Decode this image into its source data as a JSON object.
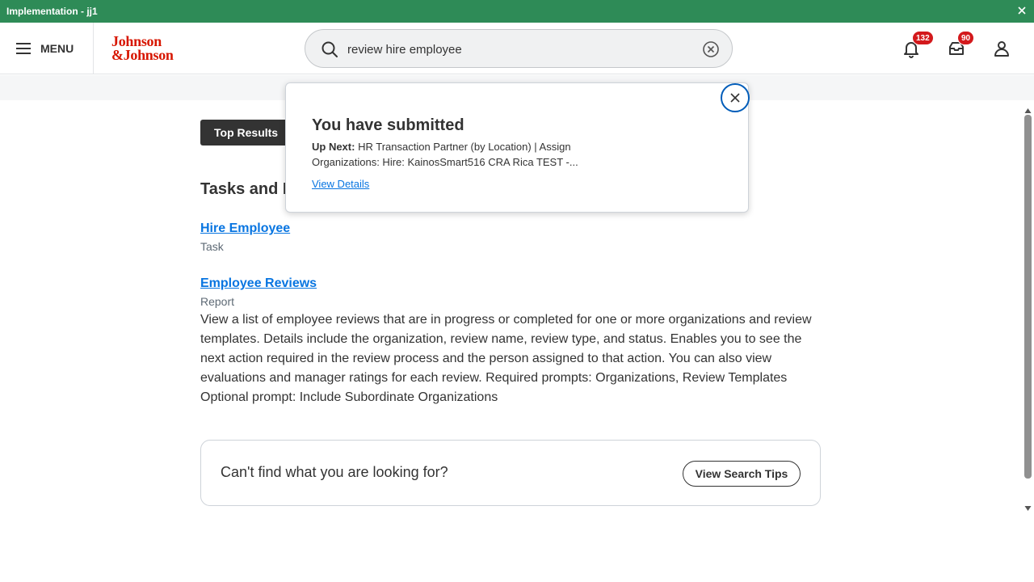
{
  "window": {
    "title": "Implementation - jj1"
  },
  "header": {
    "menu_label": "MENU",
    "logo_line1": "Johnson",
    "logo_line2": "&Johnson",
    "search_value": "review hire employee",
    "notifications_count": "132",
    "inbox_count": "90"
  },
  "main": {
    "top_results_tab": "Top Results",
    "section_title": "Tasks and R",
    "results": [
      {
        "title": "Hire Employee",
        "type": "Task"
      },
      {
        "title": "Employee Reviews",
        "type": "Report",
        "description": "View a list of employee reviews that are in progress or completed for one or more organizations and review templates. Details include the organization, review name, review type, and status. Enables you to see the next action required in the review process and the person assigned to that action. You can also view evaluations and manager ratings for each review. Required prompts: Organizations, Review Templates Optional prompt: Include Subordinate Organizations"
      }
    ],
    "cant_find": "Can't find what you are looking for?",
    "view_search_tips": "View Search Tips"
  },
  "popup": {
    "title": "You have submitted",
    "up_next_label": "Up Next:",
    "up_next_text": "HR Transaction Partner (by Location) | Assign Organizations: Hire: KainosSmart516 CRA Rica TEST -...",
    "view_details": "View Details"
  },
  "colors": {
    "titlebar": "#2e8b57",
    "logo": "#d71600",
    "link": "#0875e1",
    "badge": "#d3191c",
    "close_ring": "#005cb9"
  }
}
